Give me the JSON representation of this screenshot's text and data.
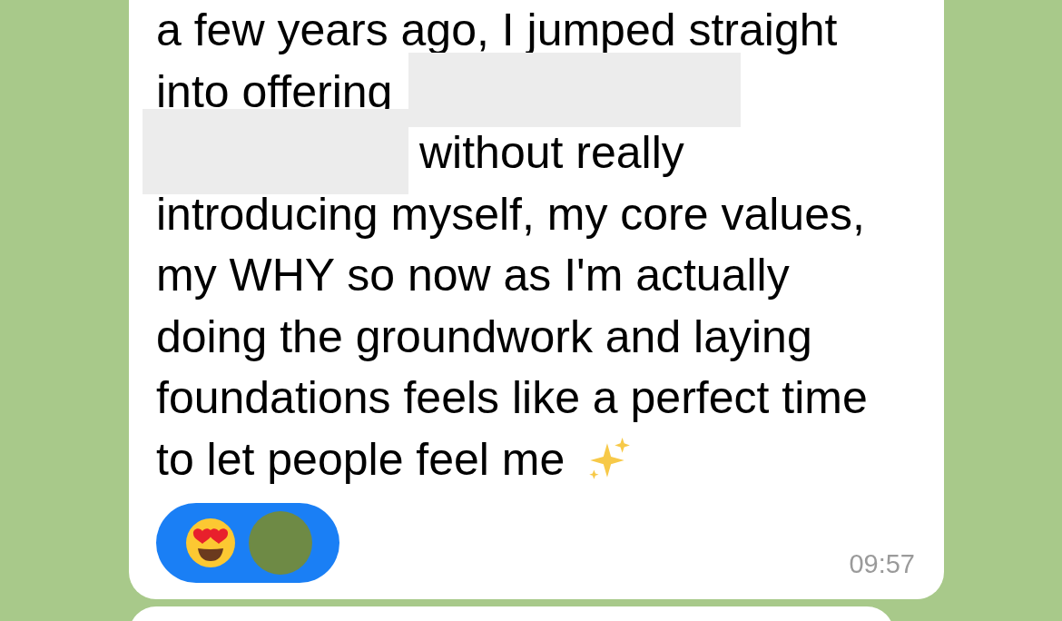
{
  "message": {
    "lines": [
      [
        {
          "kind": "text",
          "text": "a few years ago, I jumped straight"
        }
      ],
      [
        {
          "kind": "text",
          "text": "into offering"
        },
        {
          "kind": "redaction"
        }
      ],
      [
        {
          "kind": "redaction"
        },
        {
          "kind": "text",
          "text": "without really"
        }
      ],
      [
        {
          "kind": "text",
          "text": "introducing myself, my core values,"
        }
      ],
      [
        {
          "kind": "text",
          "text": "my WHY so now as I'm actually"
        }
      ],
      [
        {
          "kind": "text",
          "text": "doing the groundwork and laying"
        }
      ],
      [
        {
          "kind": "text",
          "text": "foundations feels like a perfect time"
        }
      ],
      [
        {
          "kind": "text",
          "text": "to let people feel me"
        },
        {
          "kind": "sparkles"
        }
      ]
    ],
    "reaction": {
      "selected": true,
      "items": [
        {
          "kind": "emoji"
        },
        {
          "kind": "avatar"
        }
      ]
    },
    "time": "09:57"
  }
}
